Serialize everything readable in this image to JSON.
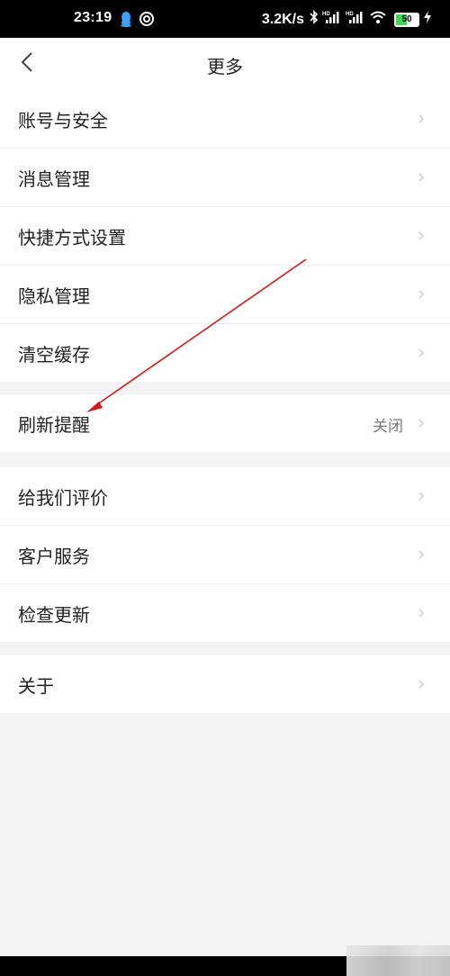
{
  "status_bar": {
    "time": "23:19",
    "network_speed": "3.2K/s",
    "battery_level": "50",
    "icons": [
      "qq-icon",
      "sync-icon",
      "bluetooth-icon",
      "hd-signal-icon",
      "hd-signal-icon",
      "wifi-icon",
      "battery-icon",
      "charging-icon"
    ]
  },
  "header": {
    "title": "更多",
    "back_icon": "chevron-left-icon"
  },
  "groups": [
    {
      "items": [
        {
          "label": "账号与安全"
        },
        {
          "label": "消息管理"
        },
        {
          "label": "快捷方式设置"
        },
        {
          "label": "隐私管理"
        },
        {
          "label": "清空缓存"
        }
      ]
    },
    {
      "items": [
        {
          "label": "刷新提醒",
          "value": "关闭"
        }
      ]
    },
    {
      "items": [
        {
          "label": "给我们评价"
        },
        {
          "label": "客户服务"
        },
        {
          "label": "检查更新"
        }
      ]
    },
    {
      "items": [
        {
          "label": "关于"
        }
      ]
    }
  ],
  "colors": {
    "background": "#f3f3f3",
    "annotation_arrow": "#d11a1a",
    "battery_fill": "#43d35a"
  }
}
